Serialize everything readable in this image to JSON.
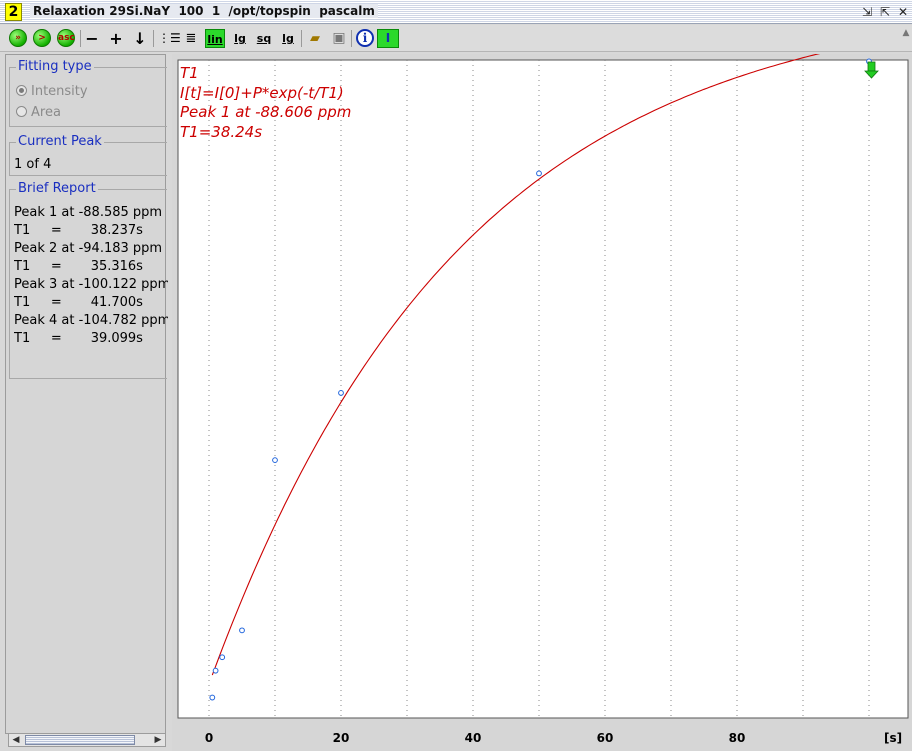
{
  "window": {
    "number": "2",
    "title": "Relaxation 29Si.NaY  100  1  /opt/topspin  pascalm"
  },
  "toolbar": {
    "btn_fit": "»",
    "btn_next": ">",
    "btn_asc": "asc",
    "btn_minus": "−",
    "btn_plus": "+",
    "btn_down": "↓",
    "btn_lin": "lin",
    "btn_lg": "lg",
    "btn_sq": "sq",
    "btn_lg2": "lg",
    "btn_info": "i",
    "btn_peak": "I"
  },
  "fitting_type": {
    "title": "Fitting type",
    "options": [
      "Intensity",
      "Area"
    ],
    "selected": "Intensity"
  },
  "current_peak": {
    "title": "Current Peak",
    "value": "1 of 4"
  },
  "brief_report": {
    "title": "Brief Report",
    "lines": [
      "Peak 1 at -88.585 ppm",
      "T1     =       38.237s",
      "Peak 2 at -94.183 ppm",
      "T1     =       35.316s",
      "Peak 3 at -100.122 ppm",
      "T1     =       41.700s",
      "Peak 4 at -104.782 ppm",
      "T1     =       39.099s"
    ]
  },
  "plot": {
    "annotation": [
      "T1",
      "I[t]=I[0]+P*exp(-t/T1)",
      "Peak  1 at -88.606 ppm",
      "T1=38.24s"
    ],
    "annotation_color": "#cc0000",
    "x_unit": "[s]"
  },
  "chart_data": {
    "type": "scatter",
    "x_ticks": [
      0,
      20,
      40,
      60,
      80
    ],
    "xlim": [
      -5,
      105
    ],
    "ylim": [
      0,
      1.0
    ],
    "grid": "vertical dotted",
    "points": [
      {
        "x": 0.5,
        "y": 0.03
      },
      {
        "x": 1,
        "y": 0.09
      },
      {
        "x": 2,
        "y": 0.12
      },
      {
        "x": 5,
        "y": 0.18
      },
      {
        "x": 10,
        "y": 0.56
      },
      {
        "x": 20,
        "y": 0.71
      },
      {
        "x": 50,
        "y": 1.2
      },
      {
        "x": 100,
        "y": 1.45
      }
    ],
    "fit_curve": {
      "T1": 38.24,
      "I0": 0.06,
      "P": 1.545
    },
    "point_color": "#2266dd",
    "curve_color": "#cc0000"
  }
}
